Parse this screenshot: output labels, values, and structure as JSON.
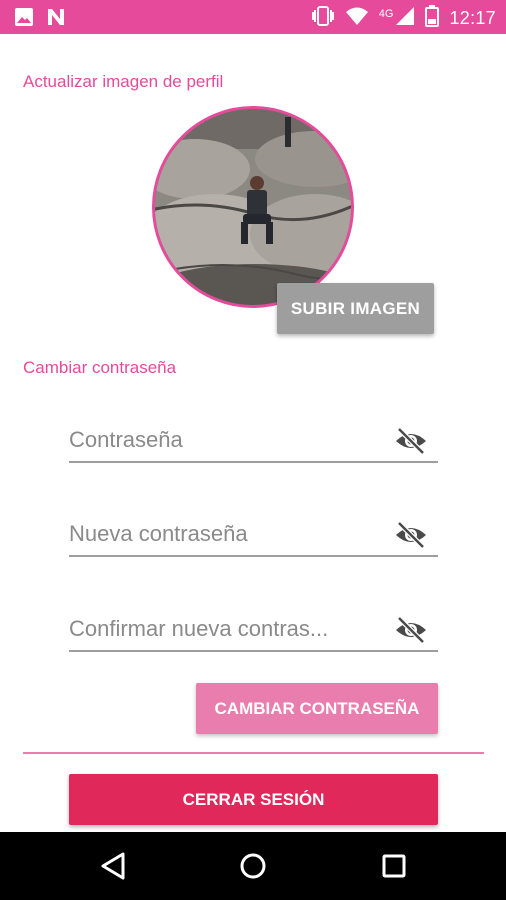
{
  "status_bar": {
    "time": "12:17",
    "network": "4G",
    "left_icons": [
      "image-icon",
      "n-notification-icon"
    ],
    "right_icons": [
      "vibrate-icon",
      "wifi-icon",
      "signal-icon",
      "battery-icon"
    ]
  },
  "profile": {
    "section_label": "Actualizar imagen de perfil",
    "upload_button": "SUBIR IMAGEN"
  },
  "password": {
    "section_label": "Cambiar contraseña",
    "fields": [
      {
        "placeholder": "Contraseña"
      },
      {
        "placeholder": "Nueva contraseña"
      },
      {
        "placeholder": "Confirmar nueva contras..."
      }
    ],
    "change_button": "CAMBIAR CONTRASEÑA"
  },
  "logout_button": "CERRAR SESIÓN",
  "nav_icons": [
    "back-icon",
    "home-icon",
    "recents-icon"
  ],
  "colors": {
    "accent": "#e64a9a",
    "change_button": "#e97dae",
    "logout_button": "#e0285a",
    "upload_button": "#9e9e9e"
  }
}
